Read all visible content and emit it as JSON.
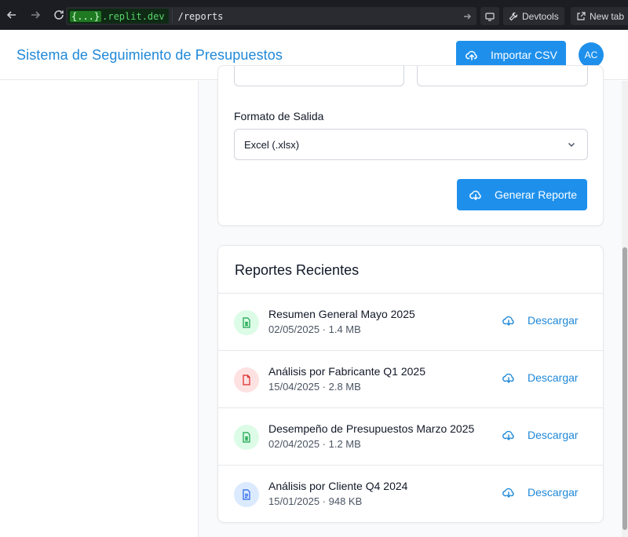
{
  "browser": {
    "host": ".replit.dev",
    "host_prefix": "{...}",
    "path": "/reports",
    "devtools_label": "Devtools",
    "new_tab_label": "New tab"
  },
  "header": {
    "title": "Sistema de Seguimiento de Presupuestos",
    "import_label": "Importar CSV",
    "avatar_initials": "AC"
  },
  "generator": {
    "format_label": "Formato de Salida",
    "format_value": "Excel (.xlsx)",
    "generate_label": "Generar Reporte"
  },
  "recent": {
    "title": "Reportes Recientes",
    "download_label": "Descargar",
    "items": [
      {
        "name": "Resumen General Mayo 2025",
        "meta": "02/05/2025 · 1.4 MB",
        "icon": "spreadsheet-icon",
        "color": "#16a34a",
        "bg": "#dcfce7"
      },
      {
        "name": "Análisis por Fabricante Q1 2025",
        "meta": "15/04/2025 · 2.8 MB",
        "icon": "pdf-file-icon",
        "color": "#dc2626",
        "bg": "#fee2e2"
      },
      {
        "name": "Desempeño de Presupuestos Marzo 2025",
        "meta": "02/04/2025 · 1.2 MB",
        "icon": "spreadsheet-icon",
        "color": "#16a34a",
        "bg": "#dcfce7"
      },
      {
        "name": "Análisis por Cliente Q4 2024",
        "meta": "15/01/2025 · 948 KB",
        "icon": "document-icon",
        "color": "#2563eb",
        "bg": "#dbeafe"
      }
    ]
  },
  "colors": {
    "primary": "#1e90ec",
    "title": "#1f88d8"
  }
}
